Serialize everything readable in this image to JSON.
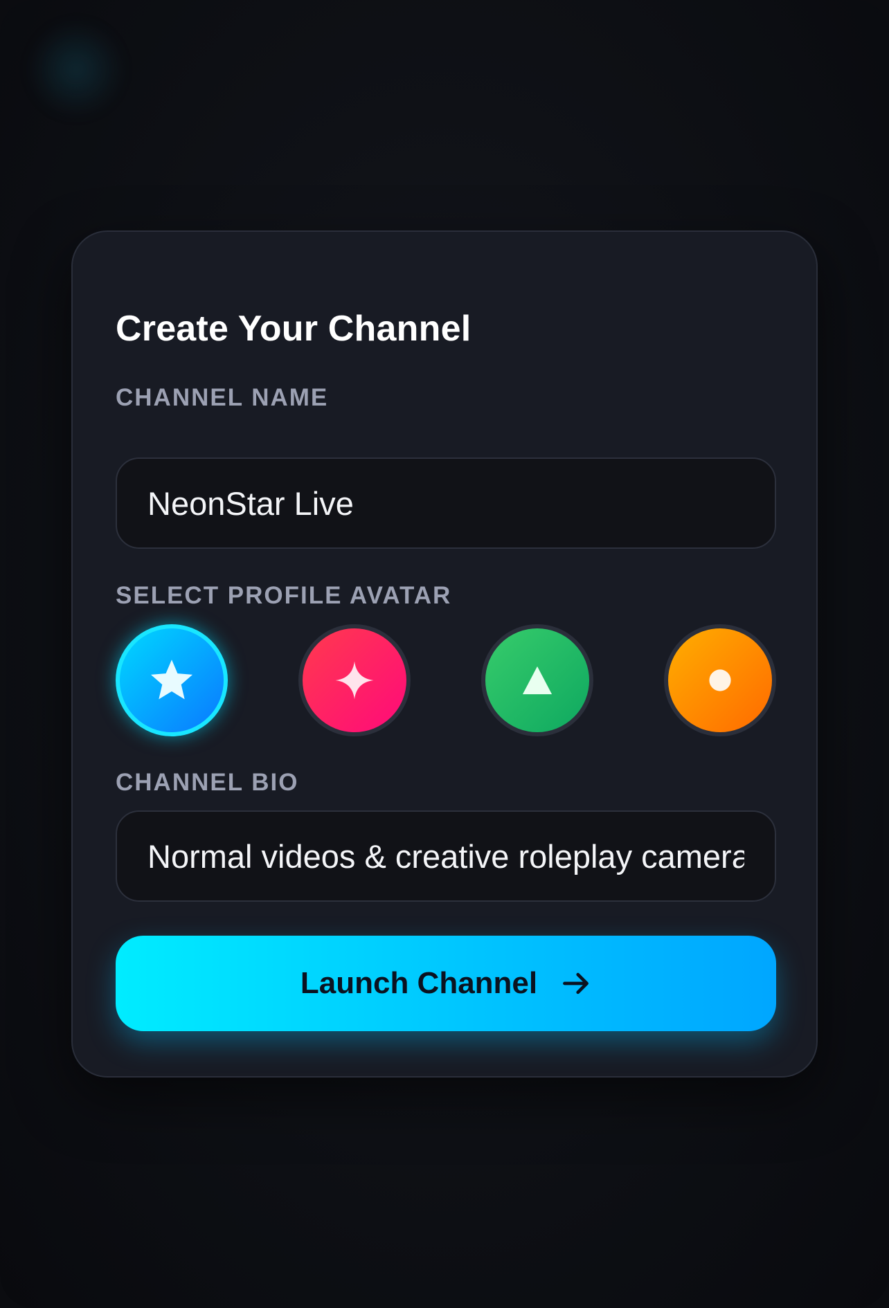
{
  "form": {
    "title": "Create Your Channel",
    "name_label": "CHANNEL NAME",
    "name_value": "NeonStar Live",
    "avatar_label": "SELECT PROFILE AVATAR",
    "bio_label": "CHANNEL BIO",
    "bio_value": "Normal videos & creative roleplay camera",
    "launch_label": "Launch Channel",
    "launch_icon": "arrow-right-icon"
  },
  "avatars": [
    {
      "icon": "star-icon",
      "color_from": "#00d8ff",
      "color_to": "#0a78ff",
      "selected": true
    },
    {
      "icon": "sparkle-icon",
      "color_from": "#ff3a4e",
      "color_to": "#ff0a7a",
      "selected": false
    },
    {
      "icon": "triangle-icon",
      "color_from": "#37cc6b",
      "color_to": "#0ea860",
      "selected": false
    },
    {
      "icon": "circle-icon",
      "color_from": "#ffae00",
      "color_to": "#ff6a00",
      "selected": false
    }
  ],
  "theme": {
    "accent": "#00c4ff",
    "selected_ring": "#19e6ff",
    "card_bg": "#181b24",
    "input_bg": "#111217"
  }
}
